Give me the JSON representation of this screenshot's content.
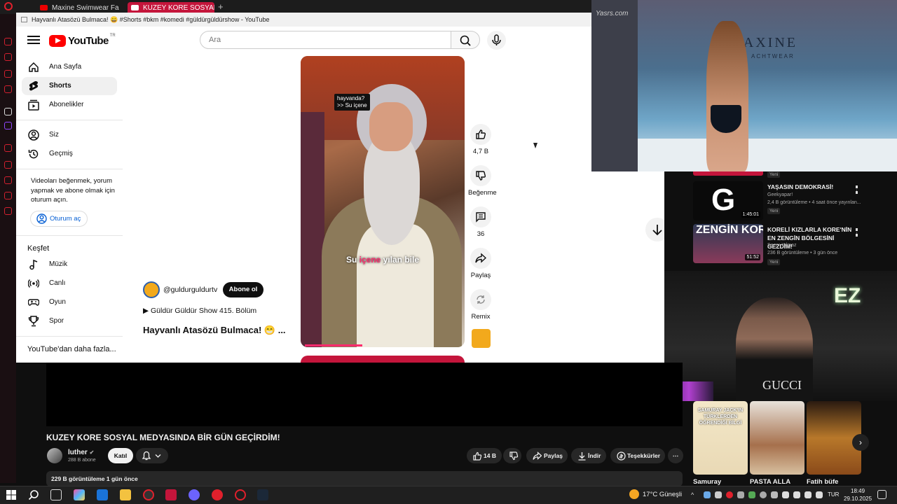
{
  "browser": {
    "tabs": [
      {
        "label": "Maxine Swimwear Fashio"
      },
      {
        "label": "KUZEY KORE SOSYAL ME"
      }
    ],
    "new_tab": "+"
  },
  "window_title": "Hayvanlı Atasözü Bulmaca! 😄 #Shorts #bkm #komedi #güldürgüldürshow - YouTube",
  "youtube": {
    "region": "TR",
    "search_placeholder": "Ara",
    "sidebar": {
      "items": [
        {
          "label": "Ana Sayfa",
          "icon": "home-icon"
        },
        {
          "label": "Shorts",
          "icon": "shorts-icon"
        },
        {
          "label": "Abonelikler",
          "icon": "subscriptions-icon"
        },
        {
          "label": "Siz",
          "icon": "account-icon"
        },
        {
          "label": "Geçmiş",
          "icon": "history-icon"
        }
      ],
      "signin_prompt": "Videoları beğenmek, yorum yapmak ve abone olmak için oturum açın.",
      "signin_button": "Oturum aç",
      "explore_heading": "Keşfet",
      "explore_items": [
        {
          "label": "Müzik",
          "icon": "music-icon"
        },
        {
          "label": "Canlı",
          "icon": "live-icon"
        },
        {
          "label": "Oyun",
          "icon": "gaming-icon"
        },
        {
          "label": "Spor",
          "icon": "trophy-icon"
        }
      ],
      "more_label": "YouTube'dan daha fazla..."
    },
    "short": {
      "bubble_line1": "hayvanda?",
      "bubble_line2": ">> Su içene",
      "caption_pre": "Su ",
      "caption_hl": "içene",
      "caption_post": " yılan bile",
      "progress": 0.37,
      "channel": "@guldurguldurtv",
      "subscribe_label": "Abone ol",
      "playlist": "Güldür Güldür Show 415. Bölüm",
      "title": "Hayvanlı Atasözü Bulmaca! 😁 ...",
      "likes": "4,7 B",
      "dislike_label": "Beğenme",
      "comments": "36",
      "share_label": "Paylaş",
      "remix_label": "Remix"
    }
  },
  "runway_overlay": {
    "watermark": "Yasrs.com",
    "brand": "MAXINE",
    "brand_sub": "ACHTWEAR"
  },
  "recommendations": {
    "top_badge": "Yeni",
    "items": [
      {
        "title": "YAŞASIN DEMOKRASİ!",
        "channel": "Geekyapar!",
        "meta": "2,4 B görüntüleme • 4 saat önce yayınlan...",
        "badge": "Yeni",
        "duration": "1:45:01"
      },
      {
        "title": "KORELİ KIZLARLA KORE'NİN EN ZENGİN BÖLGESİNİ GEZDİM!",
        "channel": "Sezer Yılmaz",
        "meta": "236 B görüntüleme • 3 gün önce",
        "badge": "Yeni",
        "duration": "51:52",
        "thumb_text": "ZENGİN KORE"
      }
    ]
  },
  "webcam": {
    "neon": "EZ",
    "shirt": "GUCCI"
  },
  "shorts_shelf": {
    "items": [
      {
        "title": "Samuray",
        "thumb_text": "SAMURAY JACK'IN TÜRKLERDEN ÖĞRENDİĞİ BİLGİ"
      },
      {
        "title": "PASTA ALLA"
      },
      {
        "title": "Fatih büfe"
      }
    ]
  },
  "main_video": {
    "title": "KUZEY KORE SOSYAL MEDYASINDA BİR GÜN GEÇİRDİM!",
    "channel": "luther",
    "subscribers": "288 B abone",
    "join_label": "Katıl",
    "likes": "14 B",
    "share_label": "Paylaş",
    "download_label": "İndir",
    "thanks_label": "Teşekkürler",
    "views_line": "229 B görüntüleme  1 gün önce"
  },
  "taskbar": {
    "weather": "17°C  Güneşli",
    "language": "TUR",
    "time": "18:49",
    "date": "29.10.2025"
  }
}
